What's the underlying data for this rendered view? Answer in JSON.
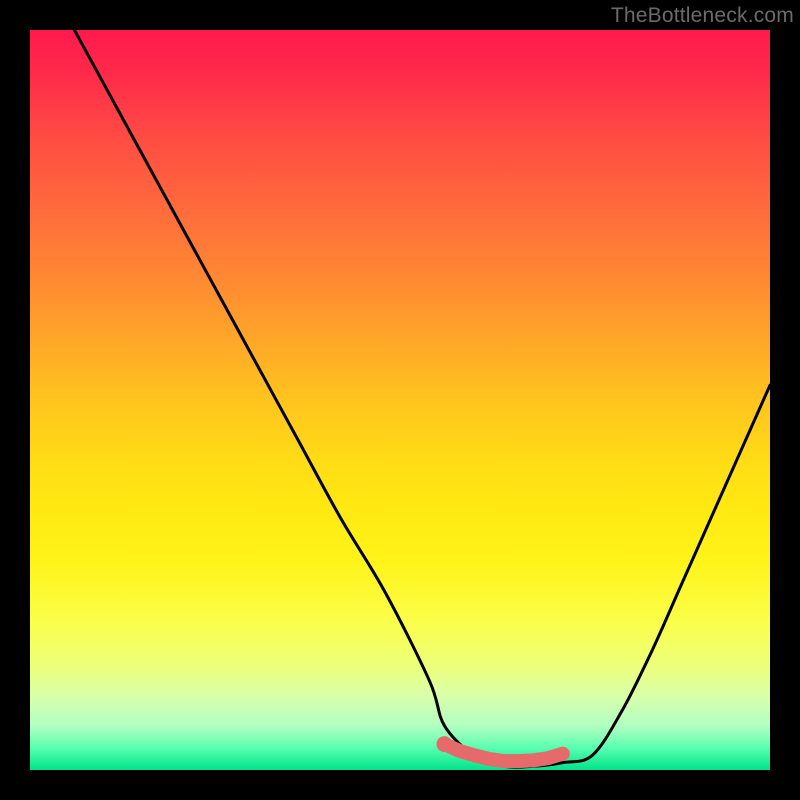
{
  "watermark": "TheBottleneck.com",
  "colors": {
    "background": "#000000",
    "curve": "#000000",
    "marker": "#e66a6a",
    "gradient_top": "#ff1a4d",
    "gradient_bottom": "#00e38a"
  },
  "chart_data": {
    "type": "line",
    "title": "",
    "xlabel": "",
    "ylabel": "",
    "xlim": [
      0,
      100
    ],
    "ylim": [
      0,
      100
    ],
    "grid": false,
    "legend": false,
    "annotations": [],
    "series": [
      {
        "name": "bottleneck-curve",
        "x": [
          6,
          12,
          18,
          24,
          30,
          36,
          42,
          48,
          54,
          56,
          60,
          64,
          68,
          72,
          76,
          80,
          84,
          88,
          92,
          96,
          100
        ],
        "y": [
          100,
          89,
          78,
          67,
          56,
          45,
          34,
          24,
          12,
          6,
          2,
          0.5,
          0.5,
          1,
          2,
          8,
          16,
          25,
          34,
          43,
          52
        ]
      }
    ],
    "markers": {
      "name": "highlighted-range",
      "color": "#e66a6a",
      "x": [
        56,
        58,
        60,
        62,
        64,
        66,
        68,
        70,
        72
      ],
      "y": [
        3.5,
        2.6,
        2.0,
        1.5,
        1.2,
        1.2,
        1.3,
        1.6,
        2.2
      ]
    }
  }
}
